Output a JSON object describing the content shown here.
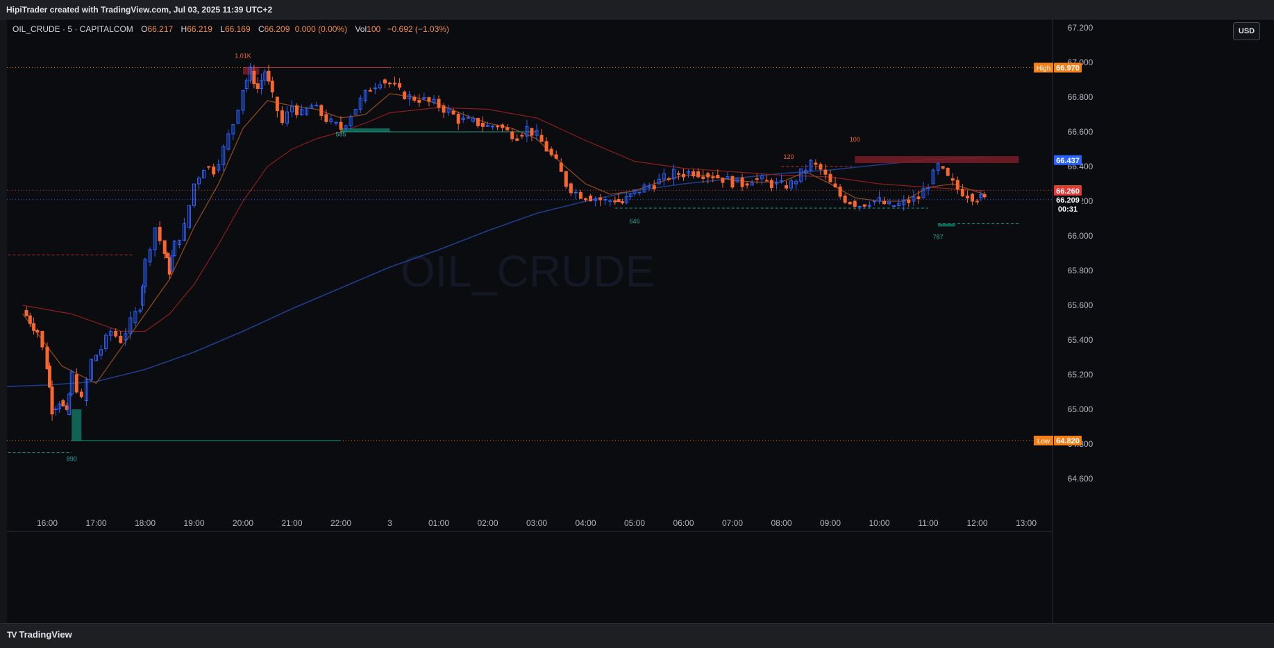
{
  "header": {
    "caption": "HipiTrader created with TradingView.com, Jul 03, 2025 11:39 UTC+2"
  },
  "legend": {
    "symbol": "OIL_CRUDE · 5 · CAPITALCOM",
    "open_label": "O",
    "open": "66.217",
    "high_label": "H",
    "high": "66.219",
    "low_label": "L",
    "low": "66.169",
    "close_label": "C",
    "close": "66.209",
    "change": "0.000 (0.00%)",
    "vol_label": "Vol",
    "vol": "100",
    "vol_change": "−0.692 (−1.03%)"
  },
  "currency_button": "USD",
  "watermark": "OIL_CRUDE",
  "footer": {
    "brand": "TradingView",
    "brand_mark": "TV"
  },
  "colors": {
    "background": "#0b0c10",
    "up": "#2962ff",
    "down": "#f7672f",
    "ema_fast": "#8a4a1c",
    "ema_slow": "#8b1e1e",
    "ema_long": "#1f3d8a",
    "high_low": "#f57f17",
    "bid_marker": "#2962ff",
    "ask_marker": "#f57f17",
    "sell_marker": "#e53935"
  },
  "chart_data": {
    "type": "line",
    "xlabel": "",
    "ylabel": "",
    "ylim": [
      64.5,
      67.28
    ],
    "grid": false,
    "price_ticks": [
      "67.200",
      "67.000",
      "66.800",
      "66.600",
      "66.400",
      "66.200",
      "66.000",
      "65.800",
      "65.600",
      "65.400",
      "65.200",
      "65.000",
      "64.800",
      "64.600"
    ],
    "time_ticks": [
      "16:00",
      "17:00",
      "18:00",
      "19:00",
      "20:00",
      "21:00",
      "22:00",
      "3",
      "01:00",
      "02:00",
      "03:00",
      "04:00",
      "05:00",
      "06:00",
      "07:00",
      "08:00",
      "09:00",
      "10:00",
      "11:00",
      "12:00",
      "13:00"
    ],
    "price_path": [
      [
        15.5,
        65.57
      ],
      [
        15.8,
        65.45
      ],
      [
        16.0,
        65.25
      ],
      [
        16.1,
        65.0
      ],
      [
        16.25,
        65.05
      ],
      [
        16.4,
        64.97
      ],
      [
        16.5,
        65.2
      ],
      [
        16.7,
        65.05
      ],
      [
        16.9,
        65.28
      ],
      [
        17.1,
        65.35
      ],
      [
        17.3,
        65.45
      ],
      [
        17.5,
        65.4
      ],
      [
        17.7,
        65.5
      ],
      [
        17.9,
        65.6
      ],
      [
        18.0,
        65.85
      ],
      [
        18.2,
        66.05
      ],
      [
        18.4,
        65.9
      ],
      [
        18.5,
        65.8
      ],
      [
        18.6,
        65.95
      ],
      [
        18.8,
        66.05
      ],
      [
        19.0,
        66.3
      ],
      [
        19.2,
        66.4
      ],
      [
        19.4,
        66.38
      ],
      [
        19.6,
        66.5
      ],
      [
        19.8,
        66.65
      ],
      [
        20.0,
        66.85
      ],
      [
        20.15,
        66.95
      ],
      [
        20.3,
        66.85
      ],
      [
        20.45,
        66.95
      ],
      [
        20.6,
        66.8
      ],
      [
        20.8,
        66.65
      ],
      [
        21.0,
        66.75
      ],
      [
        21.2,
        66.7
      ],
      [
        21.4,
        66.75
      ],
      [
        21.6,
        66.7
      ],
      [
        21.8,
        66.65
      ],
      [
        22.0,
        66.62
      ],
      [
        22.2,
        66.7
      ],
      [
        22.4,
        66.78
      ],
      [
        22.6,
        66.85
      ],
      [
        22.8,
        66.9
      ],
      [
        23.0,
        66.88
      ],
      [
        23.2,
        66.83
      ],
      [
        23.4,
        66.8
      ],
      [
        23.6,
        66.79
      ],
      [
        23.8,
        66.77
      ],
      [
        24.0,
        66.75
      ],
      [
        24.2,
        66.72
      ],
      [
        24.4,
        66.67
      ],
      [
        24.6,
        66.66
      ],
      [
        24.8,
        66.65
      ],
      [
        25.0,
        66.63
      ],
      [
        25.2,
        66.64
      ],
      [
        25.4,
        66.6
      ],
      [
        25.6,
        66.58
      ],
      [
        25.8,
        66.62
      ],
      [
        26.0,
        66.58
      ],
      [
        26.2,
        66.5
      ],
      [
        26.4,
        66.42
      ],
      [
        26.6,
        66.3
      ],
      [
        26.8,
        66.25
      ],
      [
        27.0,
        66.23
      ],
      [
        27.2,
        66.22
      ],
      [
        27.4,
        66.2
      ],
      [
        27.6,
        66.21
      ],
      [
        27.75,
        66.19
      ],
      [
        28.0,
        66.25
      ],
      [
        28.2,
        66.28
      ],
      [
        28.4,
        66.3
      ],
      [
        28.6,
        66.33
      ],
      [
        28.8,
        66.36
      ],
      [
        29.0,
        66.36
      ],
      [
        29.2,
        66.37
      ],
      [
        29.4,
        66.36
      ],
      [
        29.6,
        66.35
      ],
      [
        29.8,
        66.33
      ],
      [
        30.0,
        66.31
      ],
      [
        30.2,
        66.3
      ],
      [
        30.4,
        66.33
      ],
      [
        30.6,
        66.32
      ],
      [
        30.8,
        66.3
      ],
      [
        31.0,
        66.29
      ],
      [
        31.2,
        66.3
      ],
      [
        31.4,
        66.36
      ],
      [
        31.6,
        66.42
      ],
      [
        31.8,
        66.38
      ],
      [
        32.0,
        66.3
      ],
      [
        32.2,
        66.23
      ],
      [
        32.4,
        66.2
      ],
      [
        32.6,
        66.18
      ],
      [
        32.8,
        66.2
      ],
      [
        33.0,
        66.2
      ],
      [
        33.2,
        66.17
      ],
      [
        33.4,
        66.18
      ],
      [
        33.6,
        66.2
      ],
      [
        33.8,
        66.22
      ],
      [
        34.0,
        66.3
      ],
      [
        34.2,
        66.4
      ],
      [
        34.4,
        66.33
      ],
      [
        34.6,
        66.27
      ],
      [
        34.8,
        66.24
      ],
      [
        35.0,
        66.22
      ],
      [
        35.15,
        66.209
      ]
    ],
    "high": 66.97,
    "low": 64.82,
    "current_price": 66.209,
    "bid": 66.437,
    "ask": 66.263,
    "sell": 66.26,
    "countdown": "00:31",
    "high_label": "High",
    "high_value": "66.970",
    "low_label": "Low",
    "low_value": "64.820",
    "bid_value": "66.437",
    "ask_value": "66.263",
    "sell_value": "66.260",
    "current_value": "66.209",
    "volume_labels": [
      "1.01K",
      "585",
      "120",
      "100",
      "646",
      "787",
      "890"
    ],
    "markers": {
      "supply_zones": [
        [
          20.0,
          20.33,
          66.97,
          66.93
        ],
        [
          32.5,
          35.85,
          66.46,
          66.42
        ]
      ],
      "demand_zones": [
        [
          16.5,
          16.7,
          65.0,
          64.82
        ],
        [
          22.0,
          23.0,
          66.62,
          66.6
        ],
        [
          34.2,
          34.55,
          66.07,
          66.06
        ]
      ],
      "levels": [
        [
          20.0,
          23.0,
          66.97,
          "sell"
        ],
        [
          16.5,
          22.0,
          64.82,
          "buy"
        ],
        [
          31.0,
          32.5,
          66.4,
          "sell"
        ],
        [
          27.6,
          34.0,
          66.16,
          "buy"
        ],
        [
          22.0,
          26.0,
          66.6,
          "buy"
        ],
        [
          34.2,
          35.85,
          66.07,
          "buy"
        ],
        [
          15.0,
          16.5,
          64.75,
          "buy"
        ],
        [
          15.0,
          17.75,
          65.89,
          "sell"
        ]
      ]
    },
    "ema_fast": [
      [
        15.5,
        65.55
      ],
      [
        16.3,
        65.25
      ],
      [
        17.0,
        65.15
      ],
      [
        17.5,
        65.35
      ],
      [
        18.0,
        65.55
      ],
      [
        18.5,
        65.75
      ],
      [
        19.0,
        66.05
      ],
      [
        19.5,
        66.3
      ],
      [
        20.0,
        66.62
      ],
      [
        20.5,
        66.78
      ],
      [
        21.0,
        66.75
      ],
      [
        21.5,
        66.73
      ],
      [
        22.0,
        66.68
      ],
      [
        22.5,
        66.7
      ],
      [
        23.0,
        66.82
      ],
      [
        23.5,
        66.8
      ],
      [
        24.0,
        66.76
      ],
      [
        24.5,
        66.7
      ],
      [
        25.0,
        66.65
      ],
      [
        25.5,
        66.62
      ],
      [
        26.0,
        66.56
      ],
      [
        26.5,
        66.42
      ],
      [
        27.0,
        66.3
      ],
      [
        27.5,
        66.24
      ],
      [
        28.0,
        66.26
      ],
      [
        28.5,
        66.31
      ],
      [
        29.0,
        66.35
      ],
      [
        29.5,
        66.35
      ],
      [
        30.0,
        66.32
      ],
      [
        30.5,
        66.31
      ],
      [
        31.0,
        66.31
      ],
      [
        31.5,
        66.37
      ],
      [
        32.0,
        66.3
      ],
      [
        32.5,
        66.22
      ],
      [
        33.0,
        66.2
      ],
      [
        33.5,
        66.2
      ],
      [
        34.0,
        66.28
      ],
      [
        34.5,
        66.3
      ],
      [
        35.15,
        66.24
      ]
    ],
    "ema_slow": [
      [
        15.5,
        65.6
      ],
      [
        16.5,
        65.55
      ],
      [
        17.5,
        65.45
      ],
      [
        18.0,
        65.45
      ],
      [
        18.5,
        65.55
      ],
      [
        19.0,
        65.72
      ],
      [
        19.5,
        65.95
      ],
      [
        20.0,
        66.2
      ],
      [
        20.5,
        66.4
      ],
      [
        21.0,
        66.5
      ],
      [
        21.5,
        66.56
      ],
      [
        22.0,
        66.6
      ],
      [
        22.5,
        66.65
      ],
      [
        23.0,
        66.71
      ],
      [
        24.0,
        66.74
      ],
      [
        25.0,
        66.73
      ],
      [
        26.0,
        66.68
      ],
      [
        27.0,
        66.55
      ],
      [
        28.0,
        66.43
      ],
      [
        29.0,
        66.39
      ],
      [
        30.0,
        66.37
      ],
      [
        31.0,
        66.35
      ],
      [
        32.0,
        66.34
      ],
      [
        33.0,
        66.3
      ],
      [
        34.0,
        66.28
      ],
      [
        35.15,
        66.26
      ]
    ],
    "ema_long": [
      [
        15.0,
        65.13
      ],
      [
        16.0,
        65.14
      ],
      [
        17.0,
        65.16
      ],
      [
        18.0,
        65.23
      ],
      [
        19.0,
        65.33
      ],
      [
        20.0,
        65.45
      ],
      [
        21.0,
        65.58
      ],
      [
        22.0,
        65.7
      ],
      [
        23.0,
        65.82
      ],
      [
        24.0,
        65.92
      ],
      [
        25.0,
        66.03
      ],
      [
        26.0,
        66.13
      ],
      [
        27.0,
        66.2
      ],
      [
        28.0,
        66.26
      ],
      [
        29.0,
        66.3
      ],
      [
        30.0,
        66.33
      ],
      [
        31.0,
        66.36
      ],
      [
        32.0,
        66.38
      ],
      [
        33.0,
        66.41
      ],
      [
        34.0,
        66.44
      ],
      [
        35.15,
        66.45
      ]
    ]
  }
}
